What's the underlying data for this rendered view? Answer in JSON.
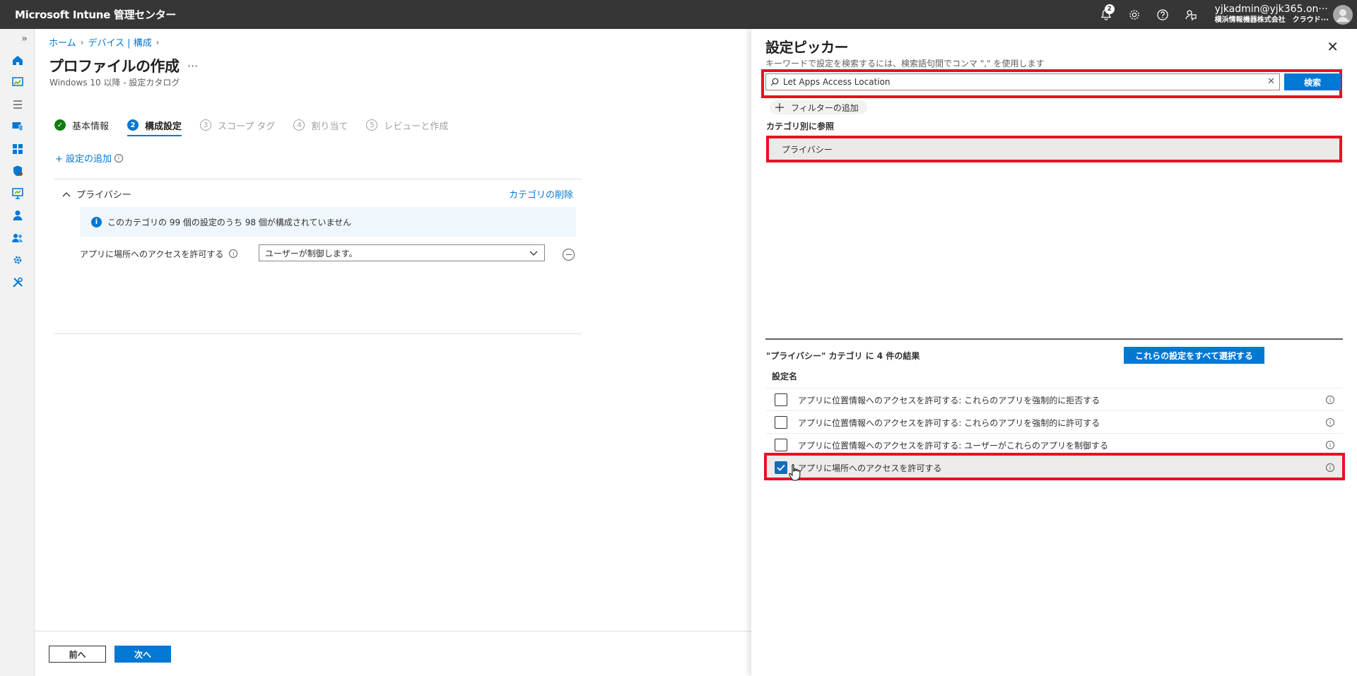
{
  "app": {
    "title": "Microsoft Intune 管理センター",
    "notifications_count": "2",
    "user_name": "yjkadmin@yjk365.on···",
    "user_org": "横浜情報機器株式会社　クラウド···"
  },
  "rail": {
    "expand_label": "»"
  },
  "breadcrumb": {
    "items": [
      "ホーム",
      "デバイス | 構成"
    ]
  },
  "page": {
    "title": "プロファイルの作成",
    "more": "···",
    "subtitle": "Windows 10 以降 - 設定カタログ"
  },
  "wizard": {
    "steps": [
      {
        "num": "✓",
        "label": "基本情報",
        "state": "done"
      },
      {
        "num": "2",
        "label": "構成設定",
        "state": "active"
      },
      {
        "num": "3",
        "label": "スコープ タグ",
        "state": "todo"
      },
      {
        "num": "4",
        "label": "割り当て",
        "state": "todo"
      },
      {
        "num": "5",
        "label": "レビューと作成",
        "state": "todo"
      }
    ]
  },
  "config": {
    "add_setting": "+ 設定の追加",
    "category_name": "プライバシー",
    "category_remove": "カテゴリの削除",
    "info_message": "このカテゴリの 99 個の設定のうち 98 個が構成されていません",
    "setting_label": "アプリに場所へのアクセスを許可する",
    "setting_value": "ユーザーが制御します。"
  },
  "footer": {
    "prev": "前へ",
    "next": "次へ"
  },
  "picker": {
    "title": "設定ピッカー",
    "close": "✕",
    "hint": "キーワードで設定を検索するには、検索語句間でコンマ \",\" を使用します",
    "search_value": "Let Apps Access Location",
    "search_clear": "✕",
    "search_button": "検索",
    "add_filter": "フィルターの追加",
    "browse_label": "カテゴリ別に参照",
    "category": "プライバシー",
    "results_label": "\"プライバシー\" カテゴリ に 4 件の結果",
    "select_all": "これらの設定をすべて選択する",
    "column_header": "設定名",
    "results": [
      {
        "label": "アプリに位置情報へのアクセスを許可する: これらのアプリを強制的に拒否する",
        "checked": false
      },
      {
        "label": "アプリに位置情報へのアクセスを許可する: これらのアプリを強制的に許可する",
        "checked": false
      },
      {
        "label": "アプリに位置情報へのアクセスを許可する: ユーザーがこれらのアプリを制御する",
        "checked": false
      },
      {
        "label": "アプリに場所へのアクセスを許可する",
        "checked": true
      }
    ]
  },
  "colors": {
    "accent": "#0078d4",
    "highlight_border": "#e81123",
    "topbar": "#363636",
    "success": "#107c10"
  }
}
